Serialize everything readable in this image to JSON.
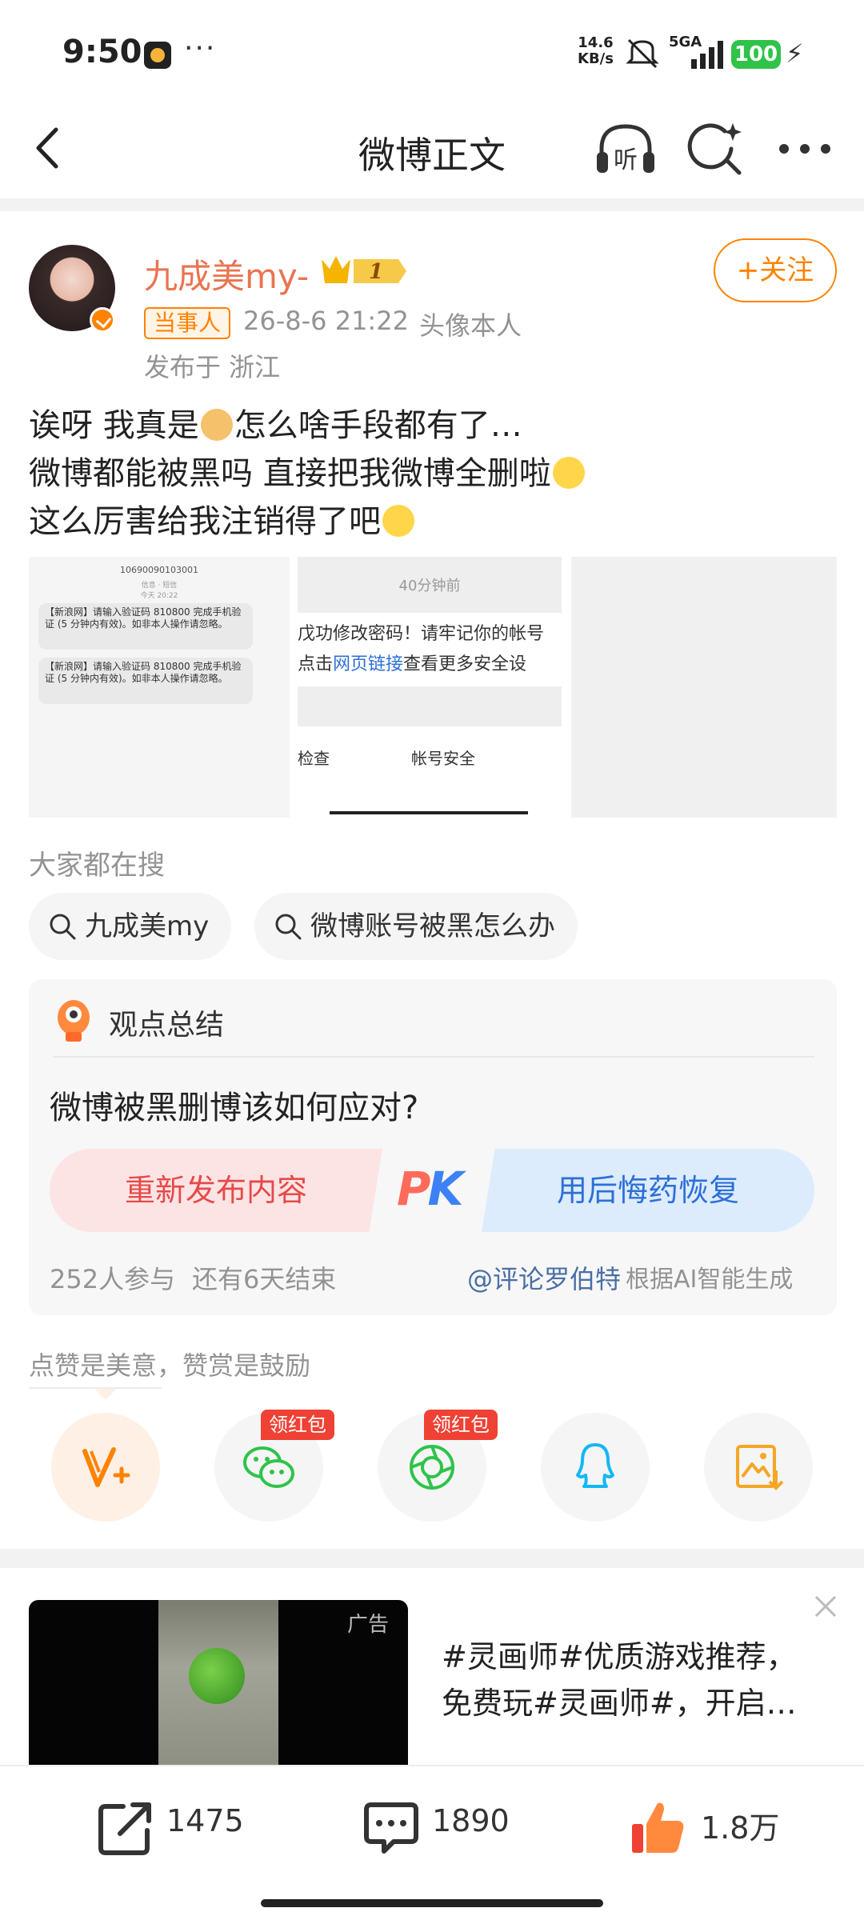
{
  "status_bar": {
    "time": "9:50",
    "speed_value": "14.6",
    "speed_unit": "KB/s",
    "network": "5GA",
    "battery": "100"
  },
  "header": {
    "title": "微博正文",
    "listen_label": "听"
  },
  "post": {
    "username": "九成美my-",
    "vip_level": "1",
    "follow_label": "+关注",
    "role_badge": "当事人",
    "time": "26-8-6 21:22",
    "avatar_label": "头像本人",
    "location": "发布于 浙江",
    "content": {
      "line1_a": "诶呀 我真是",
      "line1_b": "怎么啥手段都有了…",
      "line2": "微博都能被黑吗 直接把我微博全删啦",
      "line3": "这么厉害给我注销得了吧"
    },
    "images": {
      "img1": {
        "number": "1069009010300​1",
        "meta_a": "信息 · 短信",
        "meta_b": "今天 20:22",
        "sms1": "【新浪网】请输入验证码 810800 完成手机验证 (5 分钟内有效)。如非本人操作请忽略。",
        "sms2": "【新浪网】请输入验证码 810800 完成手机验证 (5 分钟内有效)。如非本人操作请忽略。"
      },
      "img2": {
        "time_ago": "40分钟前",
        "line1": "戊功修改密码！请牢记你的帐号",
        "line2_a": "点击",
        "line2_link": "网页链接",
        "line2_b": "查看更多安全设",
        "bottom_a": "检查",
        "bottom_b": "帐号安全"
      }
    }
  },
  "hot_search": {
    "label": "大家都在搜",
    "chips": [
      "九成美my",
      "微博账号被黑怎么办"
    ]
  },
  "summary_card": {
    "label": "观点总结",
    "question": "微博被黑删博该如何应对?",
    "option_left": "重新发布内容",
    "pk_p": "P",
    "pk_k": "K",
    "option_right": "用后悔药恢复",
    "participants": "252人参与",
    "remaining": "还有6天结束",
    "author": "@评论罗伯特",
    "source": "根据AI智能生成"
  },
  "reward": {
    "tip": "点赞是美意，赞赏是鼓励",
    "red_packet_label": "领红包"
  },
  "ad": {
    "badge": "广告",
    "line1": "#灵画师#优质游戏推荐，",
    "line2": "免费玩#灵画师#，开启…"
  },
  "bottom_bar": {
    "repost_count": "1475",
    "comment_count": "1890",
    "like_count": "1.8万"
  },
  "colors": {
    "accent_orange": "#ff8200",
    "username": "#eb7350",
    "pk_red": "#e64a4a",
    "pk_blue": "#2d6fd6"
  }
}
